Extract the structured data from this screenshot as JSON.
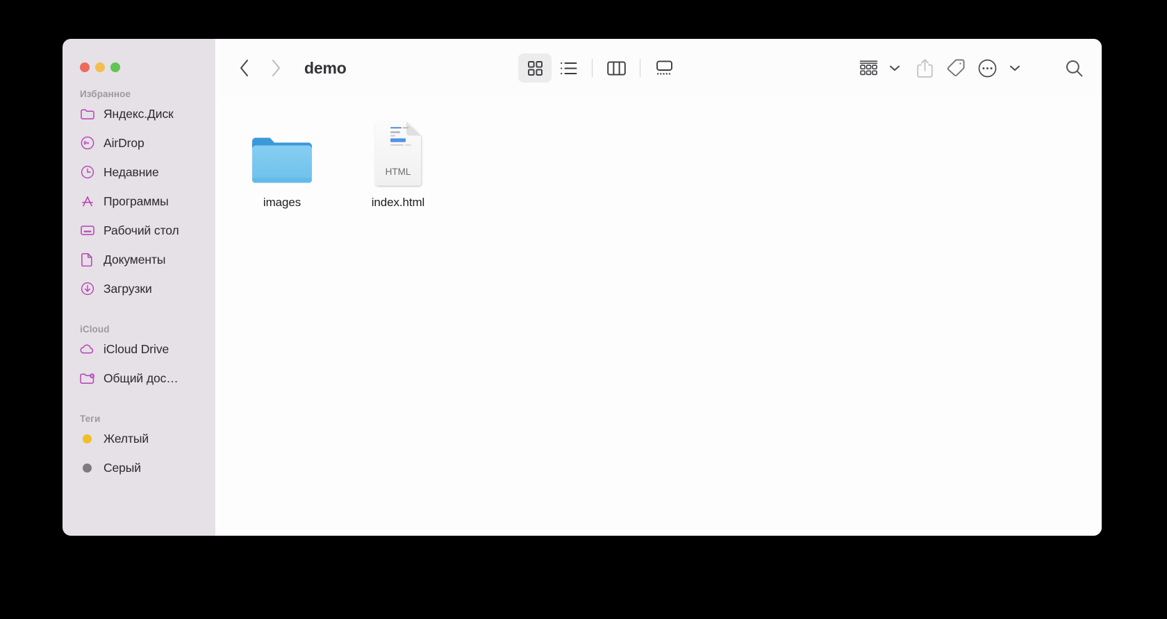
{
  "window": {
    "title": "demo",
    "traffic_lights": [
      {
        "name": "close",
        "color": "#ed6a5f"
      },
      {
        "name": "minimize",
        "color": "#f4bd4f"
      },
      {
        "name": "maximize",
        "color": "#61c554"
      }
    ]
  },
  "toolbar": {
    "back_label": "Back",
    "forward_label": "Forward",
    "views": [
      {
        "name": "icon-view",
        "label": "Icon View",
        "active": true
      },
      {
        "name": "list-view",
        "label": "List View",
        "active": false
      },
      {
        "name": "column-view",
        "label": "Column View",
        "active": false
      },
      {
        "name": "gallery-view",
        "label": "Gallery View",
        "active": false
      }
    ],
    "actions": [
      {
        "name": "group-by",
        "label": "Group"
      },
      {
        "name": "share",
        "label": "Share"
      },
      {
        "name": "tags",
        "label": "Tags"
      },
      {
        "name": "more",
        "label": "More"
      },
      {
        "name": "search",
        "label": "Search"
      }
    ]
  },
  "sidebar": {
    "sections": [
      {
        "title": "Избранное",
        "items": [
          {
            "label": "Яндекс.Диск",
            "icon": "folder-icon"
          },
          {
            "label": "AirDrop",
            "icon": "airdrop-icon"
          },
          {
            "label": "Недавние",
            "icon": "clock-icon"
          },
          {
            "label": "Программы",
            "icon": "applications-icon"
          },
          {
            "label": "Рабочий стол",
            "icon": "desktop-icon"
          },
          {
            "label": "Документы",
            "icon": "document-icon"
          },
          {
            "label": "Загрузки",
            "icon": "downloads-icon"
          }
        ]
      },
      {
        "title": "iCloud",
        "items": [
          {
            "label": "iCloud Drive",
            "icon": "cloud-icon"
          },
          {
            "label": "Общий дос…",
            "icon": "shared-folder-icon"
          }
        ]
      },
      {
        "title": "Теги",
        "items": [
          {
            "label": "Желтый",
            "icon": "tag-dot-icon",
            "color": "#f0bf27"
          },
          {
            "label": "Серый",
            "icon": "tag-dot-icon",
            "color": "#7c7c80"
          }
        ]
      }
    ],
    "accent_color": "#b93fb8"
  },
  "content": {
    "files": [
      {
        "name": "images",
        "type": "folder",
        "badge": ""
      },
      {
        "name": "index.html",
        "type": "file",
        "badge": "HTML"
      }
    ]
  }
}
